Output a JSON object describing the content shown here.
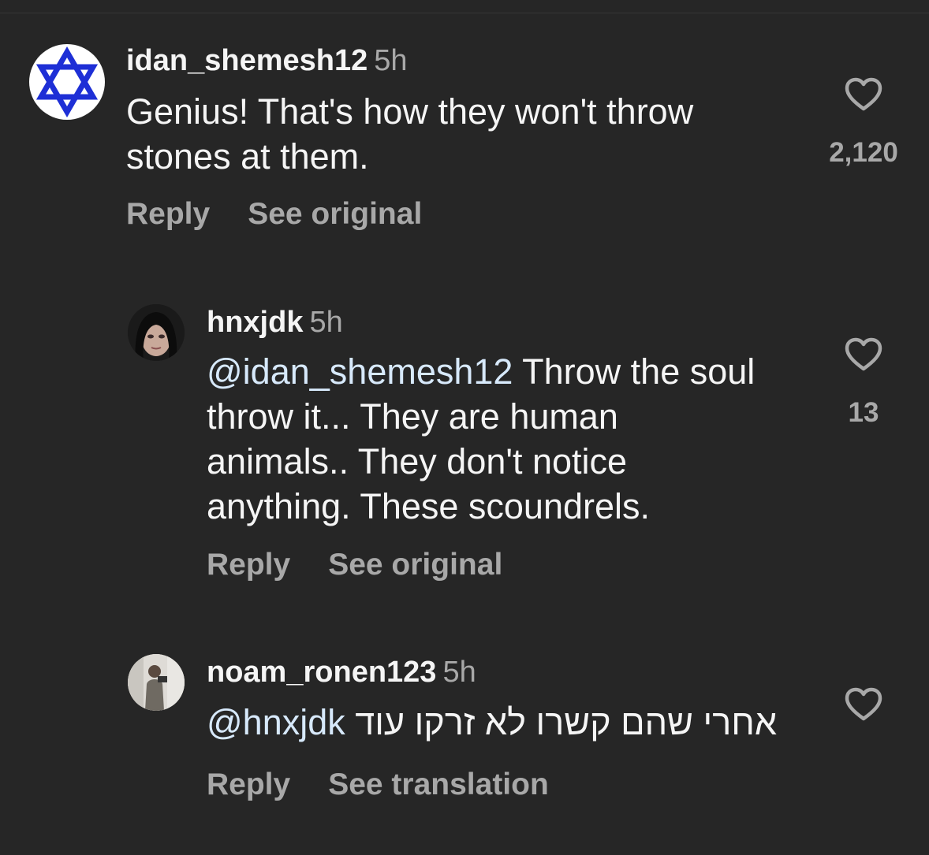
{
  "comments": [
    {
      "username": "idan_shemesh12",
      "time": "5h",
      "text": "Genius! That's how they won't throw stones at them.",
      "text_lines": [
        "Genius! That's how they won't throw",
        "stones at them."
      ],
      "likes": "2,120",
      "reply_label": "Reply",
      "secondary_label": "See original"
    },
    {
      "username": "hnxjdk",
      "time": "5h",
      "mention": "@idan_shemesh12",
      "text_lines": [
        "Throw the soul",
        "throw it... They are human",
        "animals.. They don't notice",
        "anything. These scoundrels."
      ],
      "likes": "13",
      "reply_label": "Reply",
      "secondary_label": "See original"
    },
    {
      "username": "noam_ronen123",
      "time": "5h",
      "mention": "@hnxjdk",
      "text": "אחרי שהם קשרו לא זרקו עוד",
      "reply_label": "Reply",
      "secondary_label": "See translation"
    }
  ],
  "colors": {
    "background": "#262626",
    "text": "#f5f5f5",
    "muted": "#a8a8a8",
    "mention": "#d7e9fb",
    "star_blue": "#1e2fd6"
  },
  "icons": {
    "like": "heart-outline-icon",
    "avatar1": "star-of-david-avatar"
  }
}
